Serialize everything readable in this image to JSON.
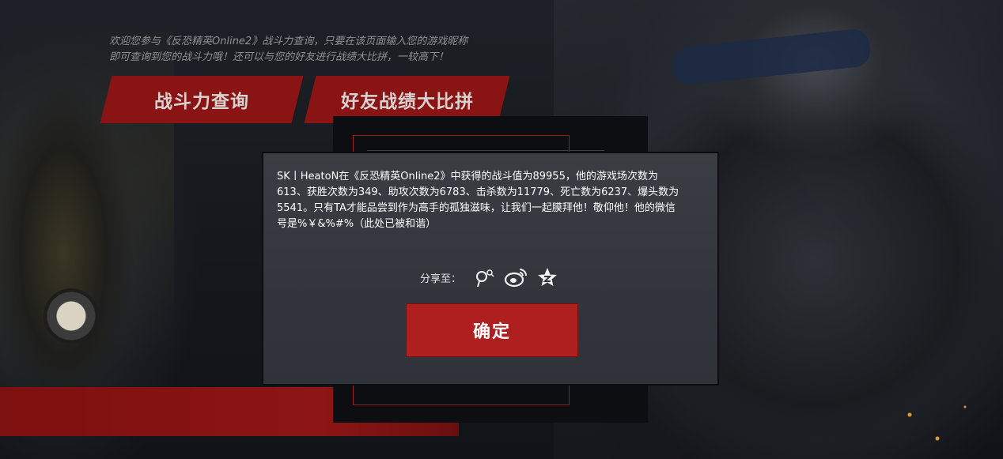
{
  "intro": {
    "line1": "欢迎您参与《反恐精英Online2》战斗力查询，只要在该页面输入您的游戏昵称",
    "line2": "即可查询到您的战斗力哦！还可以与您的好友进行战绩大比拼，一较高下！"
  },
  "tabs": [
    {
      "label": "战斗力查询"
    },
    {
      "label": "好友战绩大比拼"
    }
  ],
  "modal": {
    "message": "SK丨HeatoN在《反恐精英Online2》中获得的战斗值为89955，他的游戏场次数为\n613、获胜次数为349、助攻次数为6783、击杀数为11779、死亡数为6237、爆头数为\n5541。只有TA才能品尝到作为高手的孤独滋味，让我们一起膜拜他！敬仰他！他的微信\n号是%￥&%#%（此处已被和谐）",
    "share_label": "分享至：",
    "share_icons": [
      "qq-share-icon",
      "weibo-icon",
      "qzone-icon"
    ],
    "confirm_label": "确定"
  },
  "colors": {
    "accent_red": "#b01f1f",
    "tab_red": "#8a1414",
    "modal_bg": "#383b42"
  }
}
